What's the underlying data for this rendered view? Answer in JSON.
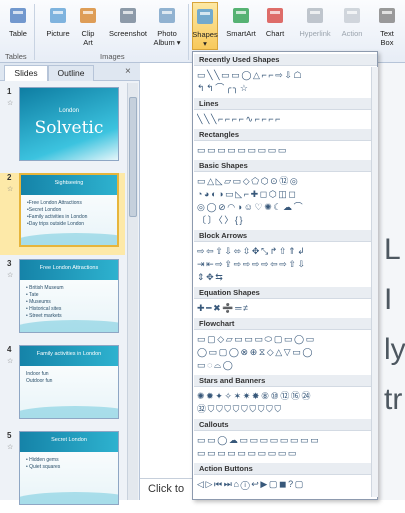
{
  "ribbon": {
    "buttons": [
      {
        "name": "table-button",
        "icon": "table-icon",
        "label": "Table"
      },
      {
        "name": "picture-button",
        "icon": "picture-icon",
        "label": "Picture"
      },
      {
        "name": "clip-art-button",
        "icon": "clip-art-icon",
        "label": "Clip\nArt"
      },
      {
        "name": "screenshot-button",
        "icon": "screenshot-icon",
        "label": "Screenshot"
      },
      {
        "name": "photo-album-button",
        "icon": "photo-album-icon",
        "label": "Photo\nAlbum ▾"
      },
      {
        "name": "shapes-button",
        "icon": "shapes-icon",
        "label": "Shapes\n▾"
      },
      {
        "name": "smartart-button",
        "icon": "smartart-icon",
        "label": "SmartArt"
      },
      {
        "name": "chart-button",
        "icon": "chart-icon",
        "label": "Chart"
      },
      {
        "name": "hyperlink-button",
        "icon": "hyperlink-icon",
        "label": "Hyperlink"
      },
      {
        "name": "action-button",
        "icon": "action-icon",
        "label": "Action"
      },
      {
        "name": "text-box-button",
        "icon": "text-box-icon",
        "label": "Text\nBox"
      }
    ],
    "groups": {
      "tables": "Tables",
      "images": "Images"
    }
  },
  "pane": {
    "tab_slides": "Slides",
    "tab_outline": "Outline",
    "close": "×"
  },
  "slides": [
    {
      "num": "1",
      "star": "☆",
      "title": "London",
      "brand": "Solvetic",
      "body": []
    },
    {
      "num": "2",
      "star": "☆",
      "title": "Sightseeing",
      "body": [
        "•Free London Attractions",
        "•Secret London",
        "•Family activities in London",
        "•Day trips outside London"
      ]
    },
    {
      "num": "3",
      "star": "☆",
      "title": "Free London Attractions",
      "body": [
        "• British Museum",
        "• Tate",
        "• Museums",
        "• Historical sites",
        "• Street markets"
      ]
    },
    {
      "num": "4",
      "star": "☆",
      "title": "Family activities in London",
      "body": [
        "Indoor fun",
        "Outdoor fun"
      ]
    },
    {
      "num": "5",
      "star": "☆",
      "title": "Secret London",
      "body": [
        "• Hidden gems",
        "• Quiet squares"
      ]
    }
  ],
  "menu": {
    "sections": [
      {
        "title": "Recently Used Shapes",
        "rows": [
          "▭╲╲▭▭◯△⌐⌐⇨⇩☖",
          "↰↰⌒╭╮☆"
        ]
      },
      {
        "title": "Lines",
        "rows": [
          "╲╲╲⌐⌐⌐⌐∿⌐⌐⌐⌐"
        ]
      },
      {
        "title": "Rectangles",
        "rows": [
          "▭▭▭▭▭▭▭▭▭"
        ]
      },
      {
        "title": "Basic Shapes",
        "rows": [
          "▭△◺▱▭◇⬠⬡⊙⑫◎",
          "◔◕◐◑▭◺⌐✚◻⬡◫◻",
          "◎◯⊘◠◑☺♡✺☾☁⌒",
          "〔〕〈〉{}"
        ]
      },
      {
        "title": "Block Arrows",
        "rows": [
          "⇨⇦⇧⇩⬄⇳✥⤡↱⇧⇑↲",
          "⇥⇤⇨⇪⇨⇨⇨⇨⇦⇨⇧⇩",
          "⇕✥⇆"
        ]
      },
      {
        "title": "Equation Shapes",
        "rows": [
          "✚━✖➗═≠"
        ]
      },
      {
        "title": "Flowchart",
        "rows": [
          "▭▢◇▱▭▭▭⬭▢▭◯▭",
          "◯▭▢◯⊗⊕⧖◇△▽▭◯",
          "▭◌⌓◯"
        ]
      },
      {
        "title": "Stars and Banners",
        "rows": [
          "✺✹✦✧✶✷✸⑧⑩⑫⑯㉔",
          "㉜⛉⛉⛉⛉⛉⛉⛉⛉⛉"
        ]
      },
      {
        "title": "Callouts",
        "rows": [
          "▭▭◯☁▭▭▭▭▭▭▭▭",
          "▭▭▭▭▭▭▭▭▭▭"
        ]
      },
      {
        "title": "Action Buttons",
        "rows": [
          "◁▷⏮⏭⌂ⓘ↩▶▢◼?▢"
        ]
      }
    ]
  },
  "editor": {
    "letters": [
      "L",
      "I",
      "ly",
      "tr"
    ]
  },
  "status": {
    "click_to": "Click to"
  },
  "colors": {
    "accent": "#1583a8",
    "selected": "#fde9a8",
    "ribbon_border": "#b6c4d8"
  }
}
